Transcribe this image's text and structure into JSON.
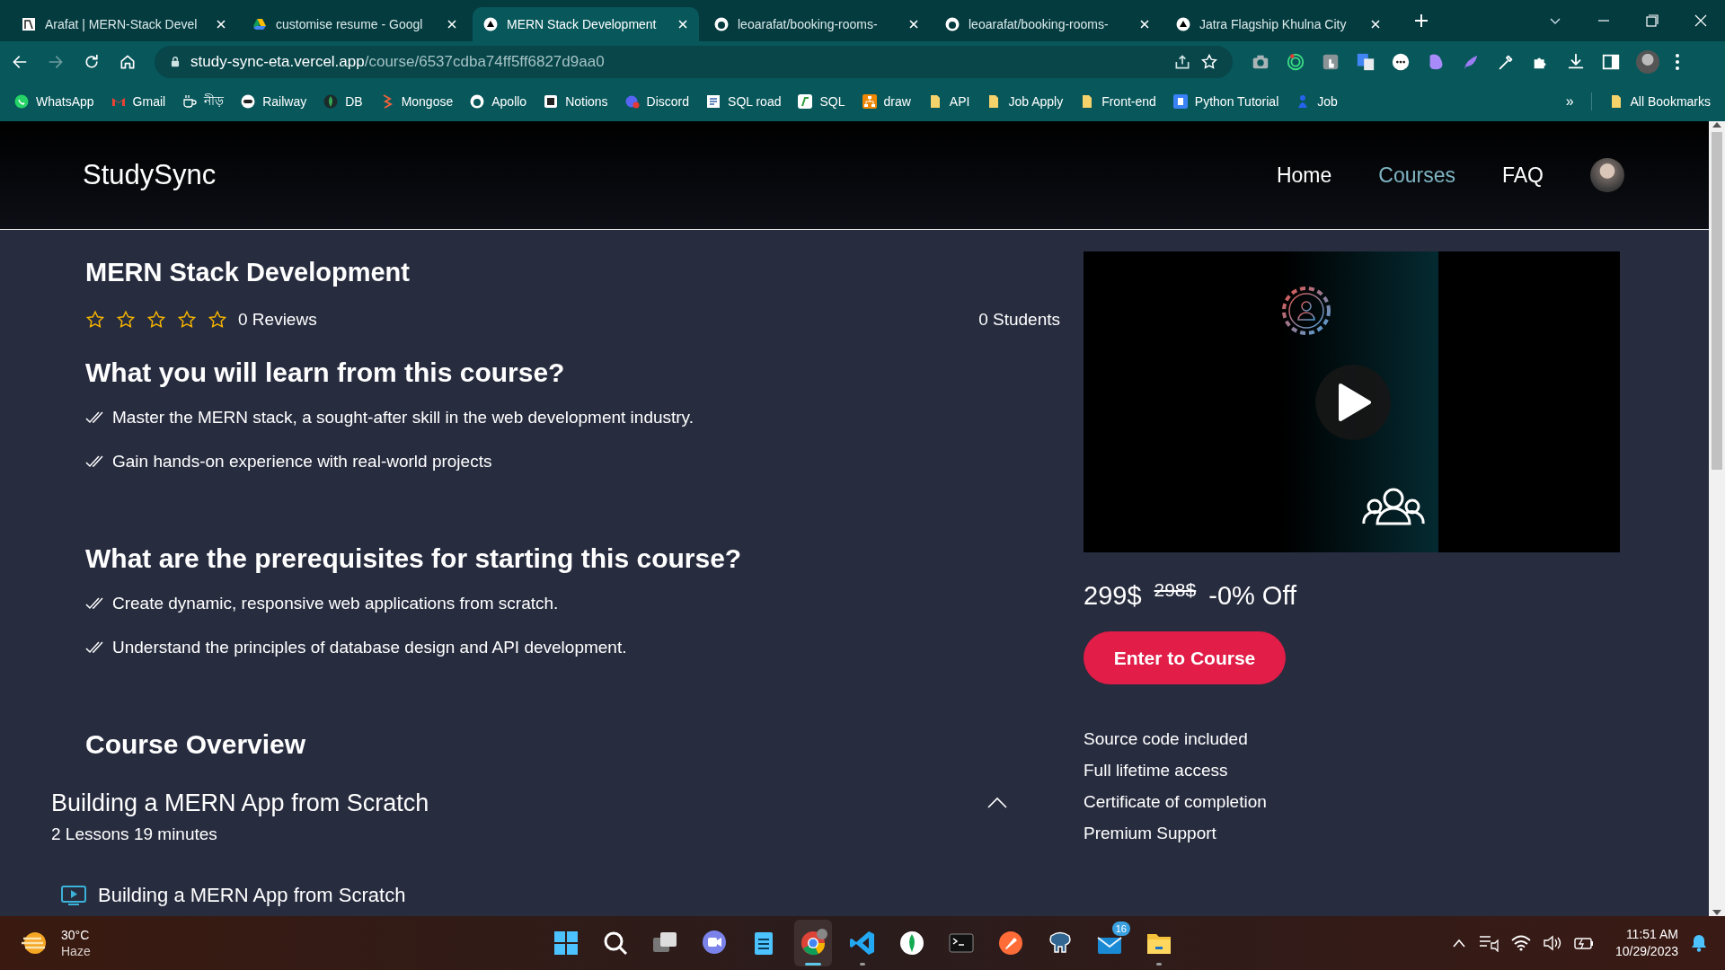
{
  "browser": {
    "tabs": [
      {
        "title": "Arafat | MERN-Stack Devel",
        "selected": false
      },
      {
        "title": "customise resume - Googl",
        "selected": false
      },
      {
        "title": "MERN Stack Development",
        "selected": true
      },
      {
        "title": "leoarafat/booking-rooms-",
        "selected": false
      },
      {
        "title": "leoarafat/booking-rooms-",
        "selected": false
      },
      {
        "title": "Jatra Flagship Khulna City",
        "selected": false
      }
    ],
    "address": {
      "host": "study-sync-eta.vercel.app",
      "path": "/course/6537cdba74ff5ff6827d9aa0"
    },
    "bookmarks": [
      "WhatsApp",
      "Gmail",
      "নীড়",
      "Railway",
      "DB",
      "Mongose",
      "Apollo",
      "Notions",
      "Discord",
      "SQL road",
      "SQL",
      "draw",
      "API",
      "Job Apply",
      "Front-end",
      "Python Tutorial",
      "Job"
    ],
    "bookmarks_overflow": "»",
    "all_bookmarks": "All Bookmarks"
  },
  "site": {
    "logo": "StudySync",
    "nav": [
      {
        "label": "Home",
        "selected": false
      },
      {
        "label": "Courses",
        "selected": true
      },
      {
        "label": "FAQ",
        "selected": false
      }
    ]
  },
  "course": {
    "title": "MERN Stack Development",
    "stars": 0,
    "reviews": "0 Reviews",
    "students": "0 Students",
    "sections": [
      {
        "heading": "What you will learn from this course?",
        "items": [
          "Master the MERN stack, a sought-after skill in the web development industry.",
          "Gain hands-on experience with real-world projects"
        ]
      },
      {
        "heading": "What are the prerequisites for starting this course?",
        "items": [
          "Create dynamic, responsive web applications from scratch.",
          "Understand the principles of database design and API development."
        ]
      }
    ],
    "overview": {
      "heading": "Course Overview",
      "modules": [
        {
          "title": "Building a MERN App from Scratch",
          "meta": "2 Lessons 19 minutes",
          "expanded": true,
          "lessons": [
            "Building a MERN App from Scratch"
          ]
        }
      ]
    }
  },
  "offer": {
    "price": "299$",
    "old_price": "298$",
    "discount": "-0% Off",
    "button": "Enter to Course",
    "features": [
      "Source code included",
      "Full lifetime access",
      "Certificate of completion",
      "Premium Support"
    ]
  },
  "taskbar": {
    "weather": {
      "temp": "30°C",
      "condition": "Haze"
    },
    "apps": [
      {
        "running": false,
        "active": false
      },
      {
        "running": false,
        "active": false
      },
      {
        "running": false,
        "active": false
      },
      {
        "running": false,
        "active": false
      },
      {
        "running": false,
        "active": false
      },
      {
        "running": true,
        "active": true
      },
      {
        "running": true,
        "active": false
      },
      {
        "running": false,
        "active": false
      },
      {
        "running": false,
        "active": false
      },
      {
        "running": false,
        "active": false
      },
      {
        "running": false,
        "active": false
      },
      {
        "running": false,
        "active": false,
        "badge": "16"
      },
      {
        "running": true,
        "active": false
      }
    ],
    "time": "11:51 AM",
    "date": "10/29/2023"
  }
}
